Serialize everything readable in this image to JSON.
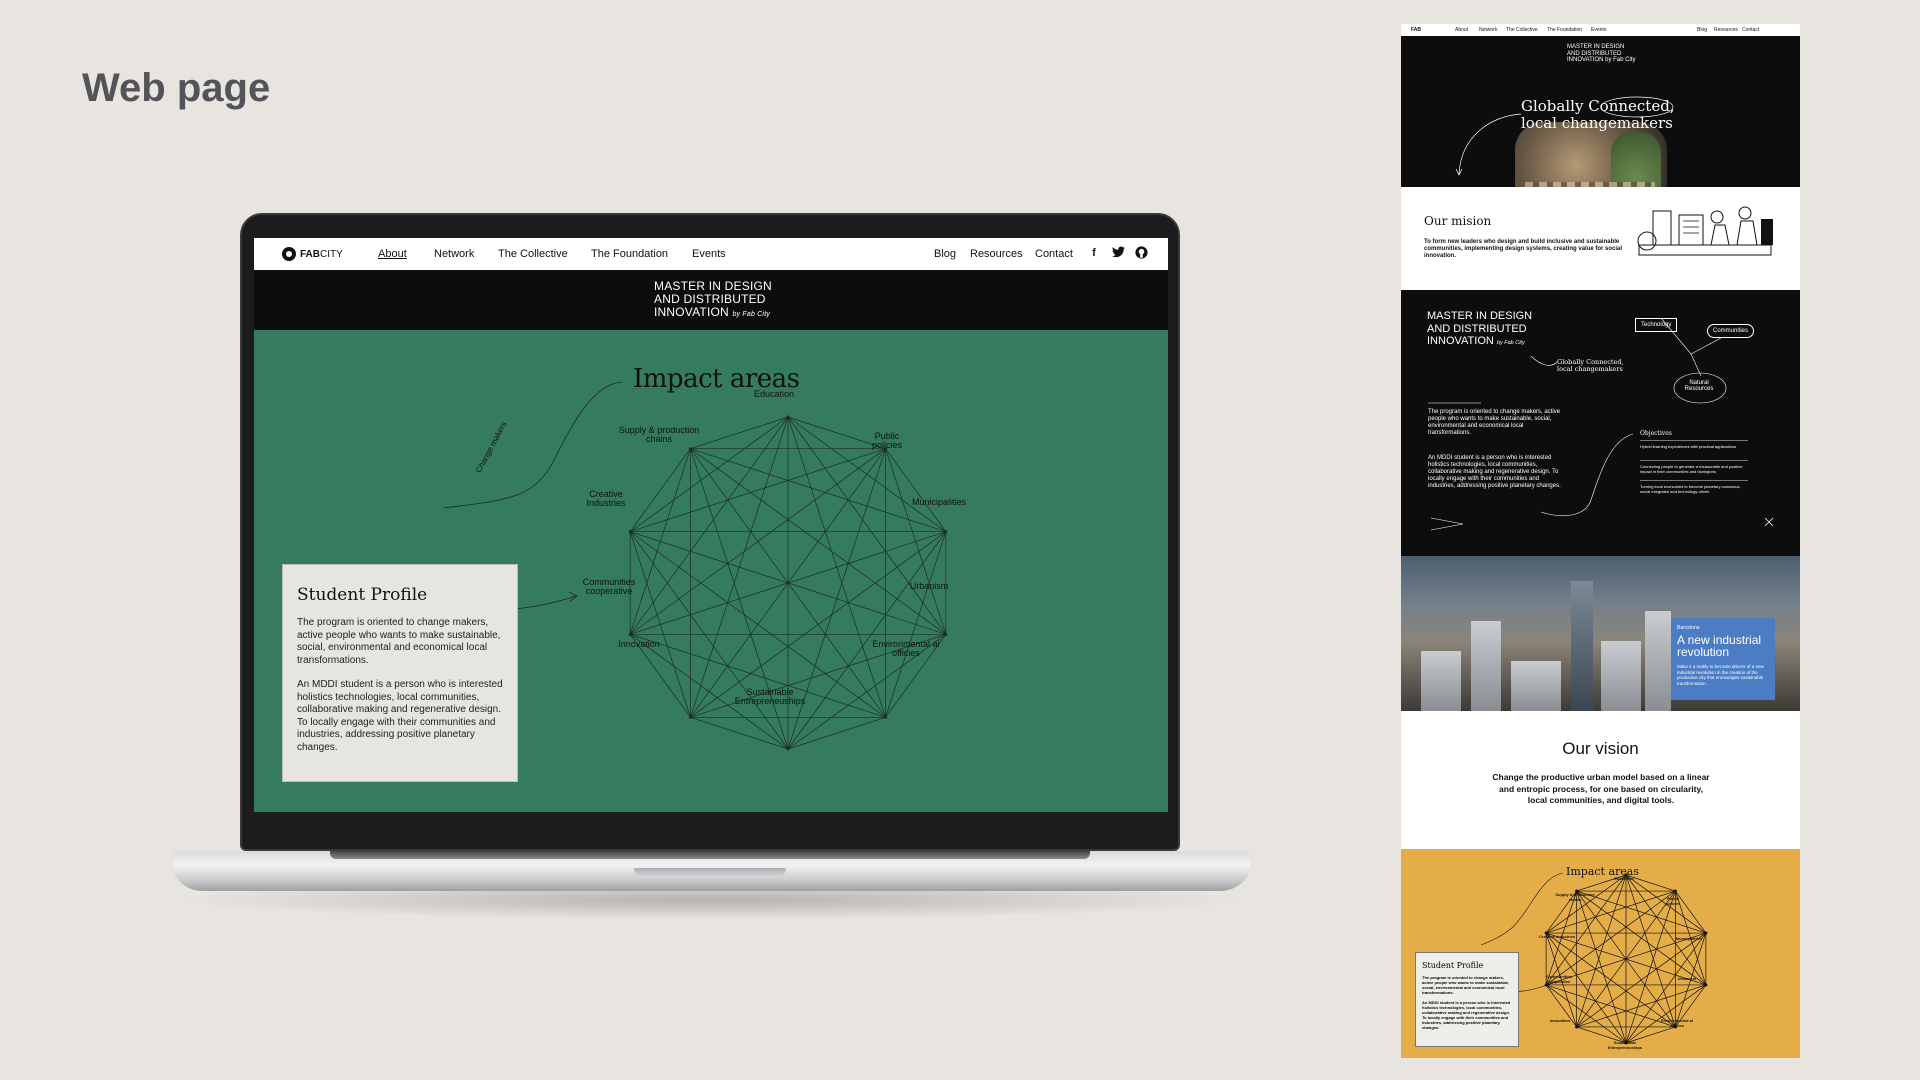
{
  "page": {
    "heading": "Web page"
  },
  "laptop": {
    "nav": {
      "logo_bold": "FAB",
      "logo_rest": "CITY",
      "items": [
        "About",
        "Network",
        "The Collective",
        "The Foundation",
        "Events"
      ],
      "right_items": [
        "Blog",
        "Resources",
        "Contact"
      ],
      "social_icons": [
        "facebook-icon",
        "twitter-icon",
        "github-icon"
      ]
    },
    "masthead": {
      "line1": "MASTER IN DESIGN",
      "line2": "AND DISTRIBUTED",
      "line3": "INNOVATION",
      "byline": "by Fab City"
    },
    "impact": {
      "title": "Impact areas",
      "side_label": "Change makers",
      "nodes": [
        {
          "label": "Education"
        },
        {
          "label": "Public policies"
        },
        {
          "label": "Municipalities"
        },
        {
          "label": "Urbanism"
        },
        {
          "label": "Environmental ai officies"
        },
        {
          "label": "Sustainable Entrepreneuships"
        },
        {
          "label": "Innovation"
        },
        {
          "label": "Communities cooperative"
        },
        {
          "label": "Creative Industries"
        },
        {
          "label": "Supply & production chains"
        }
      ],
      "color_bg": "#357c5e"
    },
    "student_profile": {
      "title": "Student Profile",
      "para1": "The program is oriented to change makers, active people who wants to make sustainable, social, environmental and economical local transformations.",
      "para2": "An MDDI student is a person who is interested holistics technologies, local communities, collaborative making and regenerative design. To locally engage with their communities and industries, addressing positive planetary changes."
    }
  },
  "longpage": {
    "nav": {
      "items": [
        "About",
        "Network",
        "The Collective",
        "The Foundation",
        "Events"
      ],
      "right_items": [
        "Blog",
        "Resources",
        "Contact"
      ]
    },
    "hero": {
      "mast1": "MASTER IN DESIGN",
      "mast2": "AND DISTRIBUTED",
      "mast3": "INNOVATION by Fab City",
      "title1": "Globally Connected,",
      "title2": "local changemakers"
    },
    "mission": {
      "title": "Our mision",
      "text": "To form new leaders who design and build inclusive and sustainable communities, implementing design systems, creating value for social innovation."
    },
    "dark": {
      "mast1": "MASTER IN DESIGN",
      "mast2": "AND DISTRIBUTED",
      "mast3": "INNOVATION",
      "byline": "by Fab City",
      "small_title1": "Globally Connected,",
      "small_title2": "local changemakers",
      "tags": [
        "Technology",
        "Communities",
        "Natural Resources"
      ],
      "p1": "The program is oriented to change makers, active people who wants to make sustainable, social, environmental and economical local transformations.",
      "p2": "An MDDI student is a person who is interested holistics technologies, local communities, collaborative making and regenerative design. To locally engage with their communities and industries, addressing positive planetary changes.",
      "objectives_title": "Objectives",
      "objectives": [
        "Hybrid learning experiences with practical applications",
        "Connecting people to generate a measurable and positive impact in their communities and bioregions",
        "Turning local economies to become planetary conscious, social integrated and technology driven"
      ]
    },
    "city": {
      "kicker": "Barcelona",
      "headline": "A new industrial revolution",
      "text": "Make it a reality to become drivers of a new industrial revolution in the creation of the productive city that encourages sustainable transformation."
    },
    "vision": {
      "title": "Our vision",
      "text": "Change the productive urban model based on a linear and entropic process, for one based on circularity, local communities, and digital tools."
    },
    "yellow": {
      "title": "Impact areas",
      "profile_title": "Student Profile",
      "p1": "The program is oriented to change makers, active people who wants to make sustainable, social, environmental and economical local transformations.",
      "p2": "An MDDI student is a person who is interested holistics technologies, local communities, collaborative making and regenerative design. To locally engage with their communities and industries, addressing positive planetary changes.",
      "color_bg": "#e5ad47"
    }
  }
}
